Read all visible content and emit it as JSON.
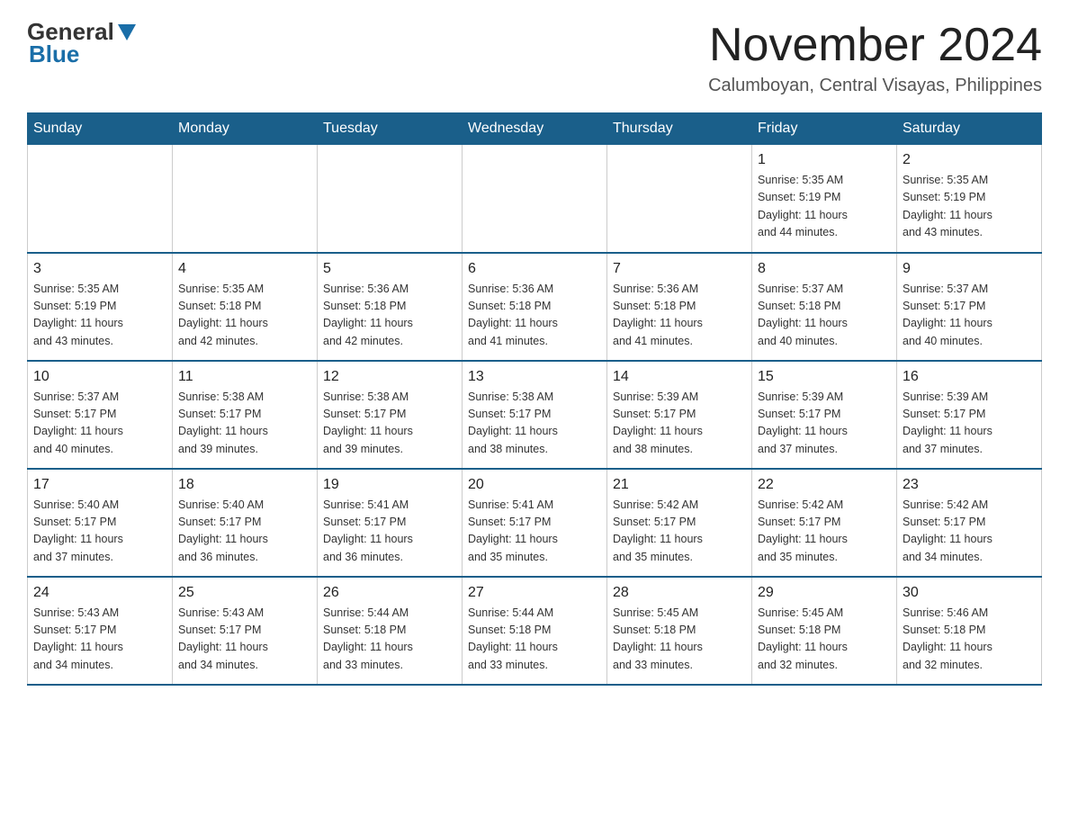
{
  "logo": {
    "general": "General",
    "blue": "Blue"
  },
  "header": {
    "month_year": "November 2024",
    "location": "Calumboyan, Central Visayas, Philippines"
  },
  "days_of_week": [
    "Sunday",
    "Monday",
    "Tuesday",
    "Wednesday",
    "Thursday",
    "Friday",
    "Saturday"
  ],
  "weeks": [
    [
      {
        "day": "",
        "info": ""
      },
      {
        "day": "",
        "info": ""
      },
      {
        "day": "",
        "info": ""
      },
      {
        "day": "",
        "info": ""
      },
      {
        "day": "",
        "info": ""
      },
      {
        "day": "1",
        "info": "Sunrise: 5:35 AM\nSunset: 5:19 PM\nDaylight: 11 hours\nand 44 minutes."
      },
      {
        "day": "2",
        "info": "Sunrise: 5:35 AM\nSunset: 5:19 PM\nDaylight: 11 hours\nand 43 minutes."
      }
    ],
    [
      {
        "day": "3",
        "info": "Sunrise: 5:35 AM\nSunset: 5:19 PM\nDaylight: 11 hours\nand 43 minutes."
      },
      {
        "day": "4",
        "info": "Sunrise: 5:35 AM\nSunset: 5:18 PM\nDaylight: 11 hours\nand 42 minutes."
      },
      {
        "day": "5",
        "info": "Sunrise: 5:36 AM\nSunset: 5:18 PM\nDaylight: 11 hours\nand 42 minutes."
      },
      {
        "day": "6",
        "info": "Sunrise: 5:36 AM\nSunset: 5:18 PM\nDaylight: 11 hours\nand 41 minutes."
      },
      {
        "day": "7",
        "info": "Sunrise: 5:36 AM\nSunset: 5:18 PM\nDaylight: 11 hours\nand 41 minutes."
      },
      {
        "day": "8",
        "info": "Sunrise: 5:37 AM\nSunset: 5:18 PM\nDaylight: 11 hours\nand 40 minutes."
      },
      {
        "day": "9",
        "info": "Sunrise: 5:37 AM\nSunset: 5:17 PM\nDaylight: 11 hours\nand 40 minutes."
      }
    ],
    [
      {
        "day": "10",
        "info": "Sunrise: 5:37 AM\nSunset: 5:17 PM\nDaylight: 11 hours\nand 40 minutes."
      },
      {
        "day": "11",
        "info": "Sunrise: 5:38 AM\nSunset: 5:17 PM\nDaylight: 11 hours\nand 39 minutes."
      },
      {
        "day": "12",
        "info": "Sunrise: 5:38 AM\nSunset: 5:17 PM\nDaylight: 11 hours\nand 39 minutes."
      },
      {
        "day": "13",
        "info": "Sunrise: 5:38 AM\nSunset: 5:17 PM\nDaylight: 11 hours\nand 38 minutes."
      },
      {
        "day": "14",
        "info": "Sunrise: 5:39 AM\nSunset: 5:17 PM\nDaylight: 11 hours\nand 38 minutes."
      },
      {
        "day": "15",
        "info": "Sunrise: 5:39 AM\nSunset: 5:17 PM\nDaylight: 11 hours\nand 37 minutes."
      },
      {
        "day": "16",
        "info": "Sunrise: 5:39 AM\nSunset: 5:17 PM\nDaylight: 11 hours\nand 37 minutes."
      }
    ],
    [
      {
        "day": "17",
        "info": "Sunrise: 5:40 AM\nSunset: 5:17 PM\nDaylight: 11 hours\nand 37 minutes."
      },
      {
        "day": "18",
        "info": "Sunrise: 5:40 AM\nSunset: 5:17 PM\nDaylight: 11 hours\nand 36 minutes."
      },
      {
        "day": "19",
        "info": "Sunrise: 5:41 AM\nSunset: 5:17 PM\nDaylight: 11 hours\nand 36 minutes."
      },
      {
        "day": "20",
        "info": "Sunrise: 5:41 AM\nSunset: 5:17 PM\nDaylight: 11 hours\nand 35 minutes."
      },
      {
        "day": "21",
        "info": "Sunrise: 5:42 AM\nSunset: 5:17 PM\nDaylight: 11 hours\nand 35 minutes."
      },
      {
        "day": "22",
        "info": "Sunrise: 5:42 AM\nSunset: 5:17 PM\nDaylight: 11 hours\nand 35 minutes."
      },
      {
        "day": "23",
        "info": "Sunrise: 5:42 AM\nSunset: 5:17 PM\nDaylight: 11 hours\nand 34 minutes."
      }
    ],
    [
      {
        "day": "24",
        "info": "Sunrise: 5:43 AM\nSunset: 5:17 PM\nDaylight: 11 hours\nand 34 minutes."
      },
      {
        "day": "25",
        "info": "Sunrise: 5:43 AM\nSunset: 5:17 PM\nDaylight: 11 hours\nand 34 minutes."
      },
      {
        "day": "26",
        "info": "Sunrise: 5:44 AM\nSunset: 5:18 PM\nDaylight: 11 hours\nand 33 minutes."
      },
      {
        "day": "27",
        "info": "Sunrise: 5:44 AM\nSunset: 5:18 PM\nDaylight: 11 hours\nand 33 minutes."
      },
      {
        "day": "28",
        "info": "Sunrise: 5:45 AM\nSunset: 5:18 PM\nDaylight: 11 hours\nand 33 minutes."
      },
      {
        "day": "29",
        "info": "Sunrise: 5:45 AM\nSunset: 5:18 PM\nDaylight: 11 hours\nand 32 minutes."
      },
      {
        "day": "30",
        "info": "Sunrise: 5:46 AM\nSunset: 5:18 PM\nDaylight: 11 hours\nand 32 minutes."
      }
    ]
  ]
}
